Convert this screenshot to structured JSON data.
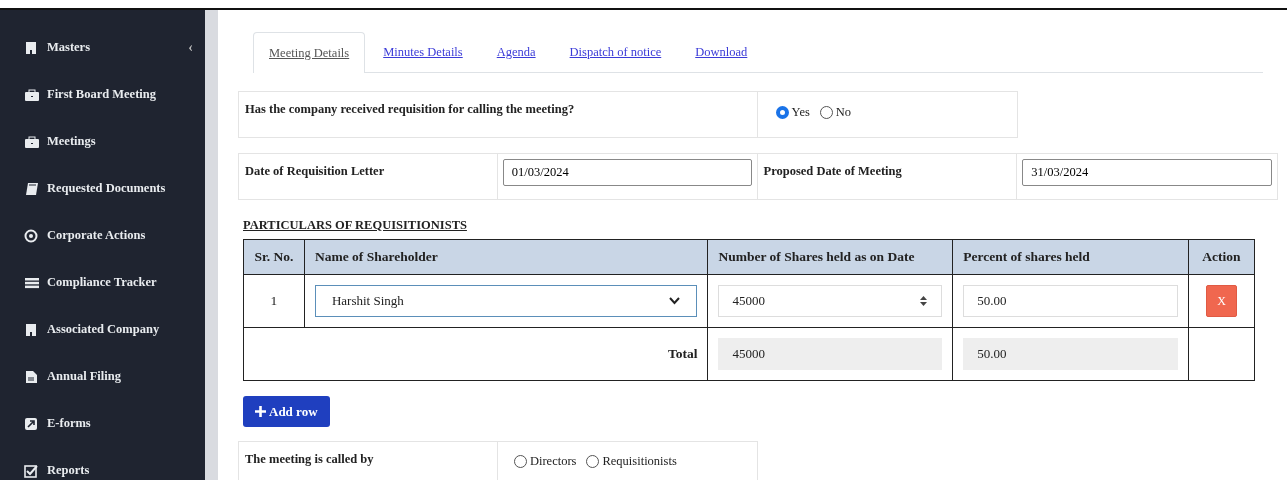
{
  "sidebar": {
    "items": [
      {
        "label": "Masters",
        "caret": "‹"
      },
      {
        "label": "First Board Meeting"
      },
      {
        "label": "Meetings"
      },
      {
        "label": "Requested Documents"
      },
      {
        "label": "Corporate Actions"
      },
      {
        "label": "Compliance Tracker"
      },
      {
        "label": "Associated Company"
      },
      {
        "label": "Annual Filing"
      },
      {
        "label": "E-forms"
      },
      {
        "label": "Reports"
      }
    ]
  },
  "tabs": [
    {
      "label": "Meeting Details",
      "selected": true
    },
    {
      "label": "Minutes Details",
      "selected": false
    },
    {
      "label": "Agenda",
      "selected": false
    },
    {
      "label": "Dispatch of notice",
      "selected": false
    },
    {
      "label": "Download",
      "selected": false
    }
  ],
  "requisition_question": {
    "label": "Has the company received requisition for calling the meeting?",
    "options": [
      {
        "label": "Yes",
        "selected": true
      },
      {
        "label": "No",
        "selected": false
      }
    ]
  },
  "dates": [
    {
      "label": "Date of Requisition Letter",
      "value": "01/03/2024"
    },
    {
      "label": "Proposed Date of Meeting",
      "value": "31/03/2024"
    }
  ],
  "section_heading": "PARTICULARS OF REQUISITIONISTS",
  "table": {
    "columns": [
      "Sr. No.",
      "Name of Shareholder",
      "Number of Shares held as on Date",
      "Percent of shares held",
      "Action"
    ],
    "rows": [
      {
        "sr": "1",
        "shareholder": "Harshit Singh",
        "shares": "45000",
        "percent": "50.00",
        "action": "X"
      }
    ],
    "total": {
      "label": "Total",
      "shares": "45000",
      "percent": "50.00"
    }
  },
  "add_row_button": "Add row",
  "called_by": {
    "label": "The meeting is called by",
    "options": [
      {
        "label": "Directors",
        "selected": false
      },
      {
        "label": "Requisitionists",
        "selected": false
      }
    ]
  }
}
